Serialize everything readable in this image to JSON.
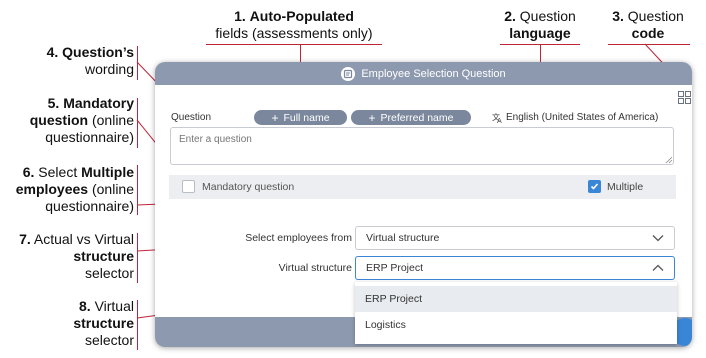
{
  "annotations": {
    "a1": {
      "num": "1.",
      "bold": "Auto-Populated",
      "rest": "fields (assessments only)"
    },
    "a2": {
      "num": "2.",
      "pre": "Question",
      "bold": "language"
    },
    "a3": {
      "num": "3.",
      "pre": "Question",
      "bold": "code"
    },
    "a4": {
      "num": "4.",
      "bold": "Question’s",
      "rest": "wording"
    },
    "a5": {
      "num": "5.",
      "bold1": "Mandatory",
      "bold2": "question",
      "rest1": "(online",
      "rest2": "questionnaire)"
    },
    "a6": {
      "num": "6.",
      "pre": "Select",
      "bold1": "Multiple",
      "bold2": "employees",
      "rest1": "(online",
      "rest2": "questionnaire)"
    },
    "a7": {
      "num": "7.",
      "pre": "Actual vs Virtual",
      "bold": "structure",
      "rest": "selector"
    },
    "a8": {
      "num": "8.",
      "pre": "Virtual",
      "bold": "structure",
      "rest": "selector"
    }
  },
  "dialog": {
    "title": "Employee Selection Question",
    "header_icon": "question-form-icon",
    "code_icon": "grid-icon",
    "question_label": "Question",
    "chips": [
      {
        "label": "Full name",
        "icon": "plus-icon"
      },
      {
        "label": "Preferred name",
        "icon": "plus-icon"
      }
    ],
    "language": {
      "label": "English (United States of America)",
      "icon": "translate-icon"
    },
    "question_input": {
      "placeholder": "Enter a question",
      "value": ""
    },
    "mandatory": {
      "label": "Mandatory question",
      "checked": false
    },
    "multiple": {
      "label": "Multiple",
      "checked": true
    },
    "select_from": {
      "label": "Select employees from",
      "value": "Virtual structure"
    },
    "virtual_structure": {
      "label": "Virtual structure",
      "value": "ERP Project"
    },
    "dropdown_options": [
      "ERP Project",
      "Logistics"
    ],
    "colors": {
      "header": "#8d99ae",
      "chip": "#7a879d",
      "accent": "#3a86d6",
      "annotation_line": "#c0243a"
    }
  }
}
